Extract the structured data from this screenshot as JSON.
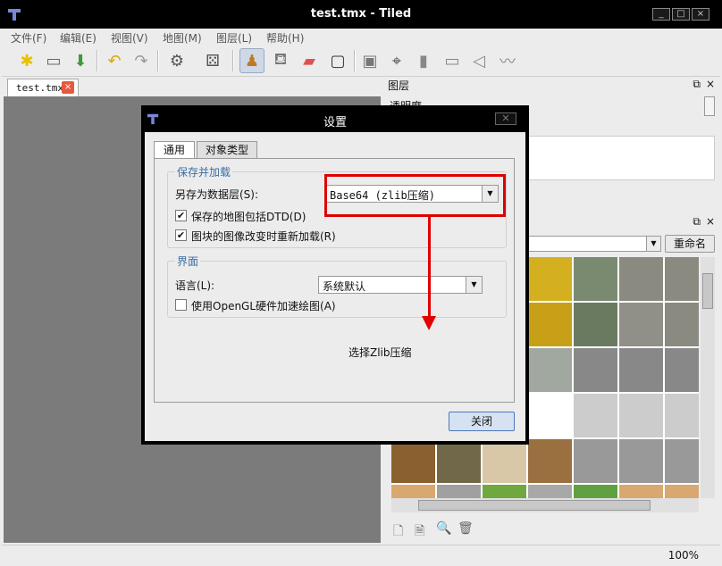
{
  "window": {
    "title": "test.tmx - Tiled",
    "controls": [
      "_",
      "□",
      "×"
    ]
  },
  "menu": [
    "文件(F)",
    "编辑(E)",
    "视图(V)",
    "地图(M)",
    "图层(L)",
    "帮助(H)"
  ],
  "toolbar": {
    "icons": [
      "new-icon",
      "open-icon",
      "save-icon",
      "undo-icon",
      "redo-icon",
      "command-icon",
      "random-icon",
      "stamp-icon",
      "bucket-icon",
      "eraser-icon",
      "rect-select-icon",
      "image-layer-icon",
      "select-objects-icon",
      "insert-tile-icon",
      "insert-image-icon",
      "insert-polygon-icon",
      "insert-polyline-icon"
    ]
  },
  "editor": {
    "tab_label": "test.tmx",
    "tab_close": "×"
  },
  "layers_panel": {
    "title": "图层",
    "float": "⧉",
    "close": "×",
    "opacity_label": "透明度"
  },
  "tilesets_panel": {
    "float": "⧉",
    "close": "×",
    "rename_label": "重命名"
  },
  "status": {
    "zoom": "100%"
  },
  "dialog": {
    "title": "设置",
    "close_glyph": "✕",
    "tabs": [
      "通用",
      "对象类型"
    ],
    "group_save": {
      "title": "保存并加载",
      "layer_format_label": "另存为数据层(S):",
      "layer_format_value": "Base64 (zlib压缩)",
      "dtd_label": "保存的地图包括DTD(D)",
      "dtd_checked": true,
      "reload_label": "图块的图像改变时重新加载(R)",
      "reload_checked": true
    },
    "group_ui": {
      "title": "界面",
      "language_label": "语言(L):",
      "language_value": "系统默认",
      "opengl_label": "使用OpenGL硬件加速绘图(A)",
      "opengl_checked": false
    },
    "close_button": "关闭"
  },
  "annotation": {
    "text": "选择Zlib压缩",
    "color": "#e00000"
  }
}
